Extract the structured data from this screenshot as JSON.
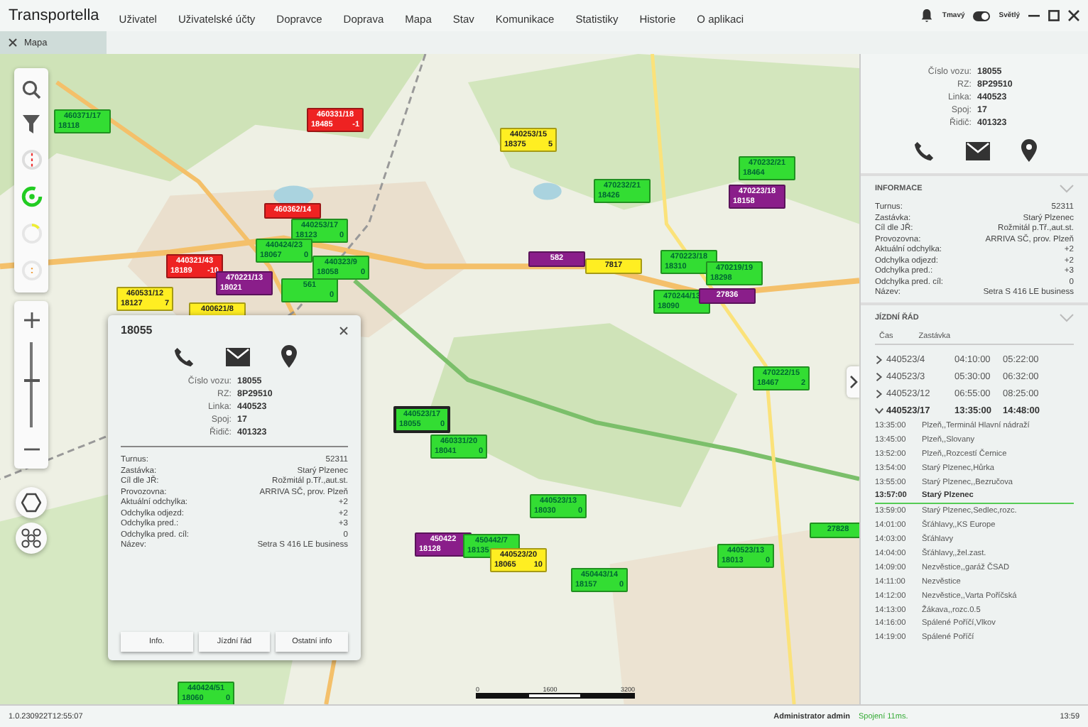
{
  "app": {
    "title": "Transportella"
  },
  "menu": [
    "Uživatel",
    "Uživatelské účty",
    "Dopravce",
    "Doprava",
    "Mapa",
    "Stav",
    "Komunikace",
    "Statistiky",
    "Historie",
    "O aplikaci"
  ],
  "theme": {
    "dark_label": "Tmavý",
    "light_label": "Světlý",
    "on": true
  },
  "tabs": [
    {
      "label": "Mapa",
      "selected": true
    }
  ],
  "zoom": {
    "level": 0.55
  },
  "markers": [
    {
      "line": "460371/17",
      "vehicle": "18118",
      "color": "#33dd33",
      "selected": false
    },
    {
      "line": "460331/18",
      "vehicle": "18485",
      "delay": "-1",
      "color": "#ee2222",
      "selected": false
    },
    {
      "line": "440253/15",
      "vehicle": "18375",
      "delay": "5",
      "color": "#ffee22",
      "selected": false
    },
    {
      "line": "470232/21",
      "vehicle": "18426",
      "color": "#33dd33",
      "selected": false
    },
    {
      "line": "470232/21",
      "vehicle": "18464",
      "color": "#33dd33",
      "selected": false
    },
    {
      "line": "470223/18",
      "vehicle": "18158",
      "color": "#8a1e8a",
      "selected": false
    },
    {
      "line": "460362/14",
      "color": "#ee2222",
      "selected": false
    },
    {
      "line": "440253/17",
      "vehicle": "18123",
      "delay": "0",
      "color": "#33dd33",
      "selected": false
    },
    {
      "line": "440424/23",
      "vehicle": "18067",
      "delay": "0",
      "color": "#33dd33",
      "selected": false
    },
    {
      "line": "440321/43",
      "vehicle": "18189",
      "delay": "-10",
      "color": "#ee2222",
      "selected": false
    },
    {
      "line": "440323/9",
      "vehicle": "18058",
      "delay": "0",
      "color": "#33dd33",
      "selected": false
    },
    {
      "line": "470221/13",
      "vehicle": "18021",
      "color": "#8a1e8a",
      "selected": false
    },
    {
      "line": "561",
      "delay": "0",
      "color": "#33dd33",
      "selected": false
    },
    {
      "line": "460531/12",
      "vehicle": "18127",
      "delay": "7",
      "color": "#ffee22",
      "selected": false
    },
    {
      "line": "400621/8",
      "color": "#ffee22",
      "selected": false
    },
    {
      "line": "582",
      "color": "#8a1e8a",
      "selected": false
    },
    {
      "line": "7817",
      "color": "#ffee22",
      "selected": false
    },
    {
      "line": "470223/18",
      "vehicle": "18310",
      "color": "#33dd33",
      "selected": false
    },
    {
      "line": "470219/19",
      "vehicle": "18298",
      "color": "#33dd33",
      "selected": false
    },
    {
      "line": "470244/13",
      "vehicle": "18090",
      "color": "#33dd33",
      "selected": false
    },
    {
      "line": "27836",
      "color": "#8a1e8a",
      "selected": false
    },
    {
      "line": "470222/15",
      "vehicle": "18467",
      "delay": "2",
      "color": "#33dd33",
      "selected": false
    },
    {
      "line": "440523/17",
      "vehicle": "18055",
      "delay": "0",
      "color": "#33dd33",
      "selected": true
    },
    {
      "line": "460331/20",
      "vehicle": "18041",
      "delay": "0",
      "color": "#33dd33",
      "selected": false
    },
    {
      "line": "440523/13",
      "vehicle": "18030",
      "delay": "0",
      "color": "#33dd33",
      "selected": false
    },
    {
      "line": "450422",
      "vehicle": "18128",
      "color": "#8a1e8a",
      "selected": false
    },
    {
      "line": "450442/7",
      "vehicle": "18135",
      "color": "#33dd33",
      "selected": false
    },
    {
      "line": "440523/20",
      "vehicle": "18065",
      "delay": "10",
      "color": "#ffee22",
      "selected": false
    },
    {
      "line": "450443/14",
      "vehicle": "18157",
      "delay": "0",
      "color": "#33dd33",
      "selected": false
    },
    {
      "line": "440523/13",
      "vehicle": "18013",
      "delay": "0",
      "color": "#33dd33",
      "selected": false
    },
    {
      "line": "27828",
      "color": "#33dd33",
      "selected": false
    },
    {
      "line": "440424/51",
      "vehicle": "18060",
      "delay": "0",
      "color": "#33dd33",
      "selected": false
    }
  ],
  "scale_labels": [
    "0",
    "1600",
    "3200"
  ],
  "popup": {
    "title": "18055",
    "vehicle_fields": [
      {
        "label": "Číslo vozu:",
        "value": "18055"
      },
      {
        "label": "RZ:",
        "value": "8P29510"
      },
      {
        "label": "Linka:",
        "value": "440523"
      },
      {
        "label": "Spoj:",
        "value": "17"
      },
      {
        "label": "Řidič:",
        "value": "401323"
      }
    ],
    "rows": [
      {
        "label": "Turnus:",
        "value": "52311"
      },
      {
        "label": "Zastávka:",
        "value": "Starý Plzenec"
      },
      {
        "label": "Cíl dle JŘ:",
        "value": "Rožmitál p.Tř.,aut.st."
      },
      {
        "label": "Provozovna:",
        "value": "ARRIVA SČ, prov. Plzeň"
      },
      {
        "label": "Aktuální odchylka:",
        "value": "+2"
      },
      {
        "label": "Odchylka odjezd:",
        "value": "+2"
      },
      {
        "label": "Odchylka pred.:",
        "value": "+3"
      },
      {
        "label": "Odchylka pred. cíl:",
        "value": "0"
      },
      {
        "label": "Název:",
        "value": "Setra S 416 LE business"
      }
    ],
    "buttons": [
      "Info.",
      "Jízdní řád",
      "Ostatní info"
    ]
  },
  "panel": {
    "vehicle_fields": [
      {
        "label": "Číslo vozu:",
        "value": "18055"
      },
      {
        "label": "RZ:",
        "value": "8P29510"
      },
      {
        "label": "Linka:",
        "value": "440523"
      },
      {
        "label": "Spoj:",
        "value": "17"
      },
      {
        "label": "Řidič:",
        "value": "401323"
      }
    ],
    "info": {
      "title": "INFORMACE",
      "expanded": true,
      "rows": [
        {
          "label": "Turnus:",
          "value": "52311"
        },
        {
          "label": "Zastávka:",
          "value": "Starý Plzenec"
        },
        {
          "label": "Cíl dle JŘ:",
          "value": "Rožmitál p.Tř.,aut.st."
        },
        {
          "label": "Provozovna:",
          "value": "ARRIVA SČ, prov. Plzeň"
        },
        {
          "label": "Aktuální odchylka:",
          "value": "+2"
        },
        {
          "label": "Odchylka odjezd:",
          "value": "+2"
        },
        {
          "label": "Odchylka pred.:",
          "value": "+3"
        },
        {
          "label": "Odchylka pred. cíl:",
          "value": "0"
        },
        {
          "label": "Název:",
          "value": "Setra S 416 LE business"
        }
      ]
    },
    "timetable": {
      "title": "JÍZDNÍ ŘÁD",
      "expanded": true,
      "columns": [
        "Čas",
        "Zastávka"
      ],
      "trips": [
        {
          "name": "440523/4",
          "start": "04:10:00",
          "end": "05:22:00",
          "expanded": false
        },
        {
          "name": "440523/3",
          "start": "05:30:00",
          "end": "06:32:00",
          "expanded": false
        },
        {
          "name": "440523/12",
          "start": "06:55:00",
          "end": "08:25:00",
          "expanded": false
        },
        {
          "name": "440523/17",
          "start": "13:35:00",
          "end": "14:48:00",
          "expanded": true,
          "stops": [
            {
              "time": "13:35:00",
              "stop": "Plzeň,,Terminál Hlavní nádraží",
              "current": false
            },
            {
              "time": "13:45:00",
              "stop": "Plzeň,,Slovany",
              "current": false
            },
            {
              "time": "13:52:00",
              "stop": "Plzeň,,Rozcestí Černice",
              "current": false
            },
            {
              "time": "13:54:00",
              "stop": "Starý Plzenec,Hůrka",
              "current": false
            },
            {
              "time": "13:55:00",
              "stop": "Starý Plzenec,,Bezručova",
              "current": false
            },
            {
              "time": "13:57:00",
              "stop": "Starý Plzenec",
              "current": true
            },
            {
              "time": "13:59:00",
              "stop": "Starý Plzenec,Sedlec,rozc.",
              "current": false
            },
            {
              "time": "14:01:00",
              "stop": "Šťáhlavy,,KS Europe",
              "current": false
            },
            {
              "time": "14:03:00",
              "stop": "Šťáhlavy",
              "current": false
            },
            {
              "time": "14:04:00",
              "stop": "Šťáhlavy,,žel.zast.",
              "current": false
            },
            {
              "time": "14:09:00",
              "stop": "Nezvěstice,,garáž ČSAD",
              "current": false
            },
            {
              "time": "14:11:00",
              "stop": "Nezvěstice",
              "current": false
            },
            {
              "time": "14:12:00",
              "stop": "Nezvěstice,,Varta Poříčská",
              "current": false
            },
            {
              "time": "14:13:00",
              "stop": "Žákava,,rozc.0.5",
              "current": false
            },
            {
              "time": "14:16:00",
              "stop": "Spálené Poříčí,Vlkov",
              "current": false
            },
            {
              "time": "14:19:00",
              "stop": "Spálené Poříčí",
              "current": false
            }
          ]
        }
      ]
    }
  },
  "status_bar": {
    "version": "1.0.230922T12:55:07",
    "user": "Administrator admin",
    "connection": "Spojení 11ms.",
    "time": "13:59"
  }
}
